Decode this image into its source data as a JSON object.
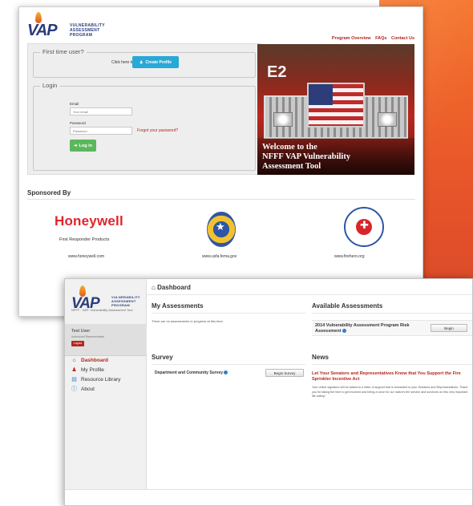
{
  "colors": {
    "brand_red": "#b3261e",
    "brand_blue": "#2a3d7b",
    "accent_orange": "#e8562a",
    "create_blue": "#2aa8d6",
    "login_green": "#5bb75b"
  },
  "landing": {
    "logo_letters": "VAP",
    "logo_words": [
      "VULNERABILITY",
      "ASSESSMENT",
      "PROGRAM"
    ],
    "nav": [
      "Program Overview",
      "FAQs",
      "Contact Us"
    ],
    "first_time_legend": "First time user?",
    "click_here": "Click here to",
    "create_profile": "Create Profile",
    "login_legend": "Login",
    "email_label": "Email",
    "email_placeholder": "Your email",
    "password_label": "Password",
    "password_placeholder": "Password",
    "forgot": "Forgot your password?",
    "login_button": "Log in",
    "hero_truck_number": "E2",
    "hero_caption": [
      "Welcome to the",
      "NFFF VAP Vulnerability",
      "Assessment Tool"
    ],
    "sponsored_by": "Sponsored By",
    "sponsors": [
      {
        "name": "Honeywell",
        "sub": "First Responder Products",
        "url": "www.honeywell.com"
      },
      {
        "name": "",
        "sub": "",
        "url": "www.usfa.fema.gov"
      },
      {
        "name": "",
        "sub": "",
        "url": "www.firehero.org"
      }
    ],
    "nff_ring": "NATIONAL FALLEN FIREFIGHTERS FOUNDATION"
  },
  "dashboard": {
    "logo_sub": "NFFF · VAP: Vulnerability Assessment Tool",
    "user_name": "Test User",
    "user_role": "Authorized Representative",
    "logout": "Logout",
    "nav": [
      {
        "label": "Dashboard",
        "icon": "home-icon",
        "color": "#b3261e"
      },
      {
        "label": "My Profile",
        "icon": "user-icon",
        "color": "#333333"
      },
      {
        "label": "Resource Library",
        "icon": "book-icon",
        "color": "#333333"
      },
      {
        "label": "About",
        "icon": "info-icon",
        "color": "#333333"
      }
    ],
    "page_title": "Dashboard",
    "my_assessments": "My Assessments",
    "no_assessments": "There are no assessments in progress at this time.",
    "available_assessments": "Available Assessments",
    "available_item": "2014 Vulnerability Assessment Program Risk Assessment",
    "begin": "Begin",
    "survey_title": "Survey",
    "survey_item": "Department and Community Survey",
    "begin_survey": "Begin Survey",
    "news_title": "News",
    "news_headline": "Let Your Senators and Representatives Know that You Support the Fire Sprinkler Incentive Act",
    "news_body": "Your online signature will be added to a letter of support that is forwarded to your Senators and Representatives. Thank you for taking the time to get involved and being a voice for our nation's fire service and survivors on this very important life safety!"
  }
}
